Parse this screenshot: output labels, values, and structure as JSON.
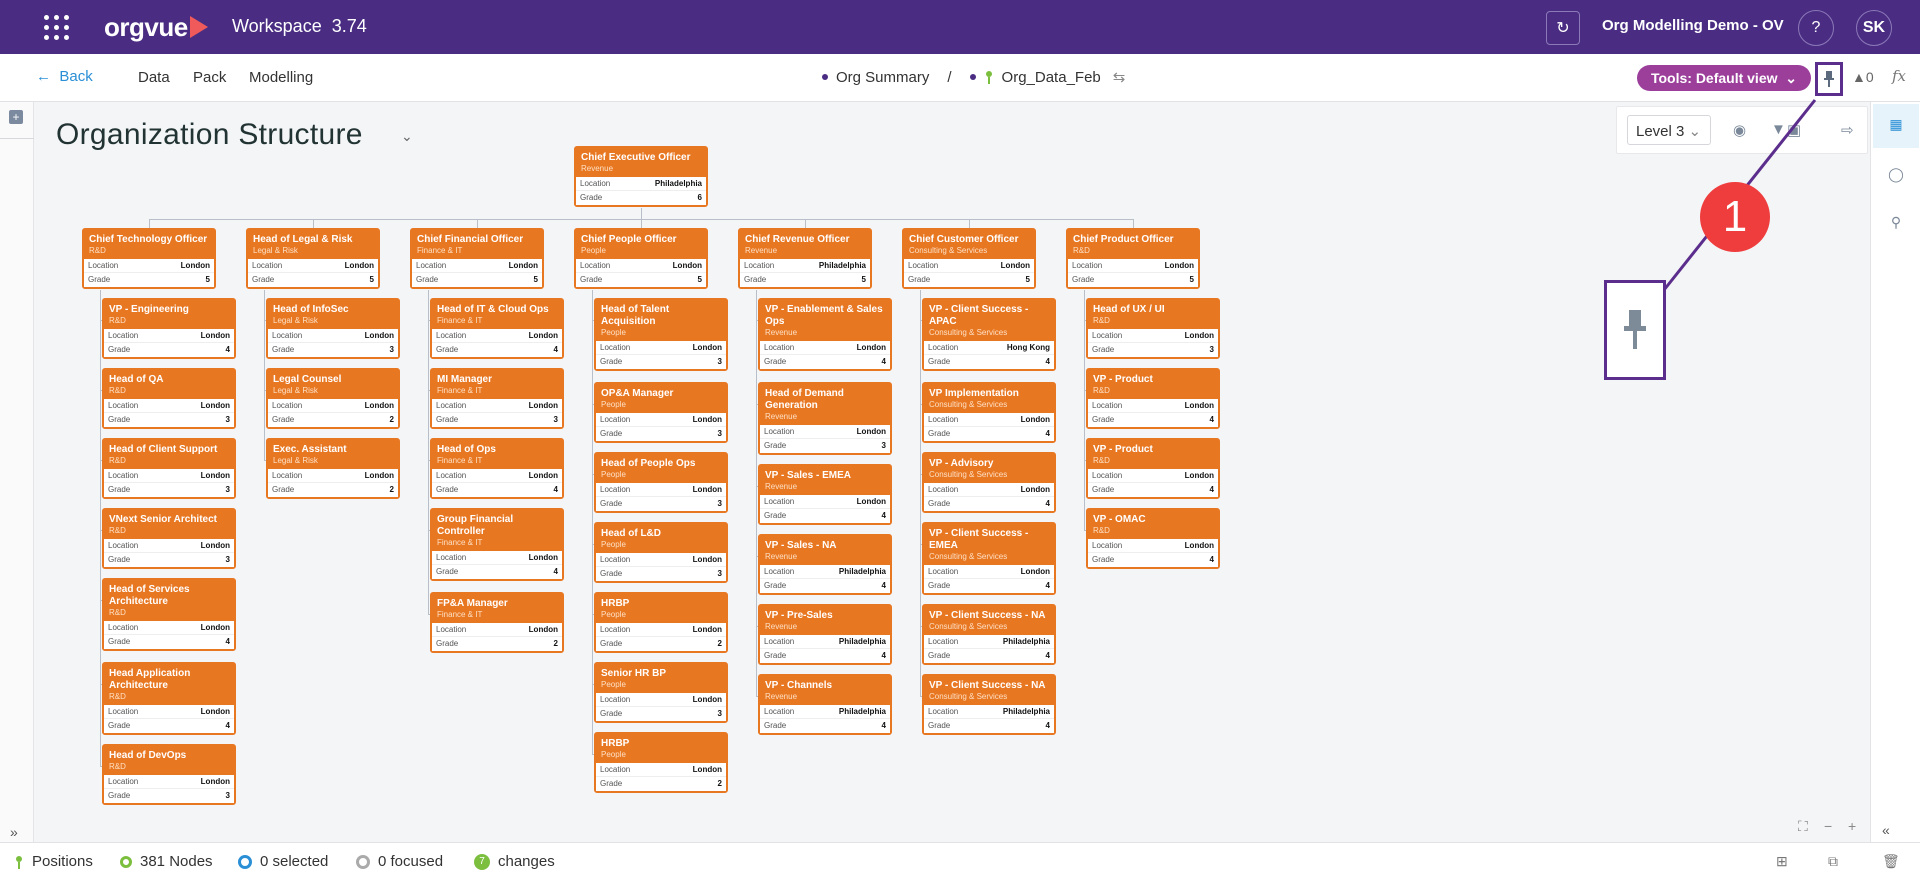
{
  "topbar": {
    "logo_text": "orgvue",
    "workspace": "Workspace",
    "version": "3.74",
    "project": "Org Modelling Demo - OV",
    "help": "?",
    "avatar": "SK"
  },
  "navbar": {
    "back": "Back",
    "items": [
      "Data",
      "Pack",
      "Modelling"
    ],
    "crumb_1": "Org Summary",
    "crumb_sep": "/",
    "crumb_2": "Org_Data_Feb",
    "tools": "Tools: Default view",
    "flask_count": "0",
    "fx": "fx"
  },
  "page": {
    "title": "Organization Structure",
    "level": "Level 3"
  },
  "annotation": {
    "callout": "1"
  },
  "labels": {
    "location": "Location",
    "grade": "Grade"
  },
  "nodes": [
    {
      "title": "Chief Executive Officer",
      "dept": "Revenue",
      "location": "Philadelphia",
      "grade": "6"
    },
    {
      "title": "Chief Technology Officer",
      "dept": "R&D",
      "location": "London",
      "grade": "5"
    },
    {
      "title": "Head of Legal & Risk",
      "dept": "Legal & Risk",
      "location": "London",
      "grade": "5"
    },
    {
      "title": "Chief Financial Officer",
      "dept": "Finance & IT",
      "location": "London",
      "grade": "5"
    },
    {
      "title": "Chief People Officer",
      "dept": "People",
      "location": "London",
      "grade": "5"
    },
    {
      "title": "Chief Revenue Officer",
      "dept": "Revenue",
      "location": "Philadelphia",
      "grade": "5"
    },
    {
      "title": "Chief Customer Officer",
      "dept": "Consulting & Services",
      "location": "London",
      "grade": "5"
    },
    {
      "title": "Chief Product Officer",
      "dept": "R&D",
      "location": "London",
      "grade": "5"
    },
    {
      "title": "VP - Engineering",
      "dept": "R&D",
      "location": "London",
      "grade": "4"
    },
    {
      "title": "Head of QA",
      "dept": "R&D",
      "location": "London",
      "grade": "3"
    },
    {
      "title": "Head of Client Support",
      "dept": "R&D",
      "location": "London",
      "grade": "3"
    },
    {
      "title": "VNext Senior Architect",
      "dept": "R&D",
      "location": "London",
      "grade": "3"
    },
    {
      "title": "Head of Services Architecture",
      "dept": "R&D",
      "location": "London",
      "grade": "4"
    },
    {
      "title": "Head Application Architecture",
      "dept": "R&D",
      "location": "London",
      "grade": "4"
    },
    {
      "title": "Head of DevOps",
      "dept": "R&D",
      "location": "London",
      "grade": "3"
    },
    {
      "title": "Head of InfoSec",
      "dept": "Legal & Risk",
      "location": "London",
      "grade": "3"
    },
    {
      "title": "Legal Counsel",
      "dept": "Legal & Risk",
      "location": "London",
      "grade": "2"
    },
    {
      "title": "Exec. Assistant",
      "dept": "Legal & Risk",
      "location": "London",
      "grade": "2"
    },
    {
      "title": "Head of IT & Cloud Ops",
      "dept": "Finance & IT",
      "location": "London",
      "grade": "4"
    },
    {
      "title": "MI Manager",
      "dept": "Finance & IT",
      "location": "London",
      "grade": "3"
    },
    {
      "title": "Head of Ops",
      "dept": "Finance & IT",
      "location": "London",
      "grade": "4"
    },
    {
      "title": "Group Financial Controller",
      "dept": "Finance & IT",
      "location": "London",
      "grade": "4"
    },
    {
      "title": "FP&A Manager",
      "dept": "Finance & IT",
      "location": "London",
      "grade": "2"
    },
    {
      "title": "Head of Talent Acquisition",
      "dept": "People",
      "location": "London",
      "grade": "3"
    },
    {
      "title": "OP&A Manager",
      "dept": "People",
      "location": "London",
      "grade": "3"
    },
    {
      "title": "Head of People Ops",
      "dept": "People",
      "location": "London",
      "grade": "3"
    },
    {
      "title": "Head of L&D",
      "dept": "People",
      "location": "London",
      "grade": "3"
    },
    {
      "title": "HRBP",
      "dept": "People",
      "location": "London",
      "grade": "2"
    },
    {
      "title": "Senior HR BP",
      "dept": "People",
      "location": "London",
      "grade": "3"
    },
    {
      "title": "HRBP",
      "dept": "People",
      "location": "London",
      "grade": "2"
    },
    {
      "title": "VP - Enablement & Sales Ops",
      "dept": "Revenue",
      "location": "London",
      "grade": "4"
    },
    {
      "title": "Head of Demand Generation",
      "dept": "Revenue",
      "location": "London",
      "grade": "3"
    },
    {
      "title": "VP - Sales - EMEA",
      "dept": "Revenue",
      "location": "London",
      "grade": "4"
    },
    {
      "title": "VP - Sales - NA",
      "dept": "Revenue",
      "location": "Philadelphia",
      "grade": "4"
    },
    {
      "title": "VP - Pre-Sales",
      "dept": "Revenue",
      "location": "Philadelphia",
      "grade": "4"
    },
    {
      "title": "VP - Channels",
      "dept": "Revenue",
      "location": "Philadelphia",
      "grade": "4"
    },
    {
      "title": "VP - Client Success - APAC",
      "dept": "Consulting & Services",
      "location": "Hong Kong",
      "grade": "4"
    },
    {
      "title": "VP Implementation",
      "dept": "Consulting & Services",
      "location": "London",
      "grade": "4"
    },
    {
      "title": "VP - Advisory",
      "dept": "Consulting & Services",
      "location": "London",
      "grade": "4"
    },
    {
      "title": "VP - Client Success - EMEA",
      "dept": "Consulting & Services",
      "location": "London",
      "grade": "4"
    },
    {
      "title": "VP - Client Success - NA",
      "dept": "Consulting & Services",
      "location": "Philadelphia",
      "grade": "4"
    },
    {
      "title": "VP - Client Success - NA",
      "dept": "Consulting & Services",
      "location": "Philadelphia",
      "grade": "4"
    },
    {
      "title": "Head of UX / UI",
      "dept": "R&D",
      "location": "London",
      "grade": "3"
    },
    {
      "title": "VP - Product",
      "dept": "R&D",
      "location": "London",
      "grade": "4"
    },
    {
      "title": "VP - Product",
      "dept": "R&D",
      "location": "London",
      "grade": "4"
    },
    {
      "title": "VP - OMAC",
      "dept": "R&D",
      "location": "London",
      "grade": "4"
    }
  ],
  "status": {
    "positions": "Positions",
    "nodes": "381 Nodes",
    "selected": "0 selected",
    "focused": "0 focused",
    "changes_count": "7",
    "changes": "changes"
  }
}
